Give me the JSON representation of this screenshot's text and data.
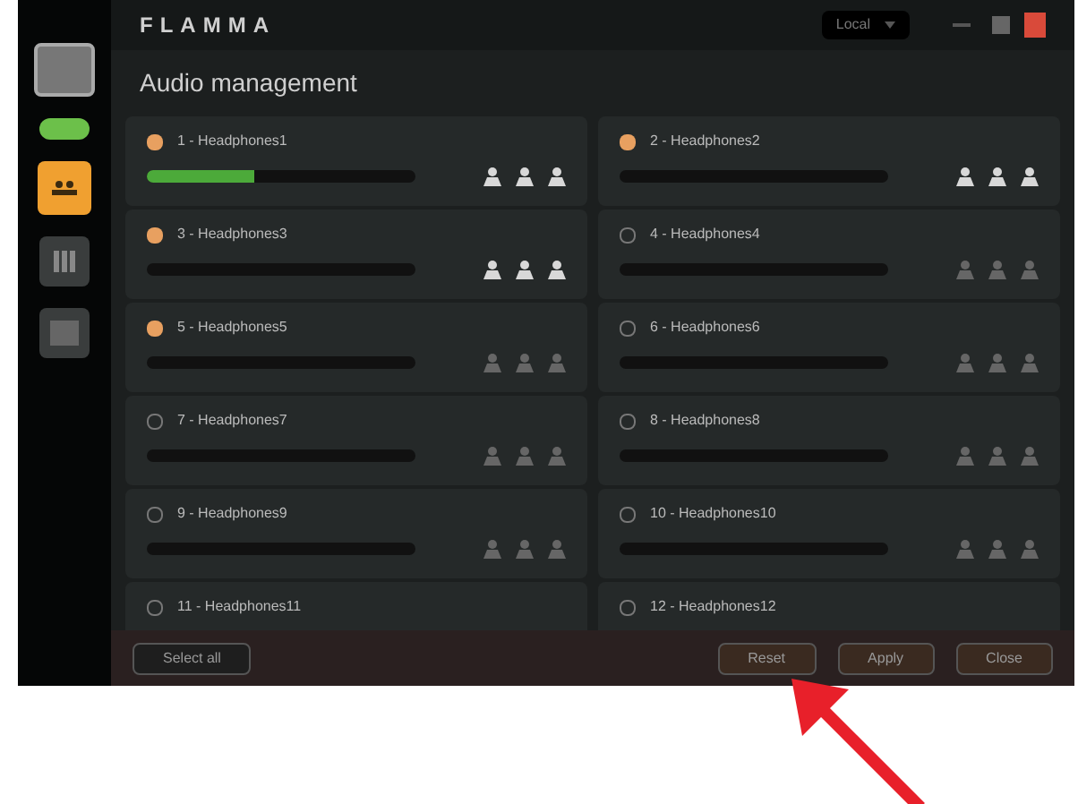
{
  "header": {
    "brand": "FLAMMA",
    "dropdown": "Local"
  },
  "sidebar": {
    "items": [
      {
        "kind": "device",
        "selected": false
      },
      {
        "kind": "toggle",
        "on": true,
        "selected": false
      },
      {
        "kind": "audio",
        "selected": true
      },
      {
        "kind": "grid",
        "selected": false
      },
      {
        "kind": "square",
        "selected": false
      }
    ]
  },
  "title": "Audio management",
  "channels": [
    {
      "label": "1 - Headphones1",
      "checked": true,
      "level": 0.4,
      "active": true
    },
    {
      "label": "2 - Headphones2",
      "checked": true,
      "level": 0,
      "active": true
    },
    {
      "label": "3 - Headphones3",
      "checked": true,
      "level": 0,
      "active": true
    },
    {
      "label": "4 - Headphones4",
      "checked": false,
      "level": 0,
      "active": false
    },
    {
      "label": "5 - Headphones5",
      "checked": true,
      "level": 0,
      "active": false
    },
    {
      "label": "6 - Headphones6",
      "checked": false,
      "level": 0,
      "active": false
    },
    {
      "label": "7 - Headphones7",
      "checked": false,
      "level": 0,
      "active": false
    },
    {
      "label": "8 - Headphones8",
      "checked": false,
      "level": 0,
      "active": false
    },
    {
      "label": "9 - Headphones9",
      "checked": false,
      "level": 0,
      "active": false
    },
    {
      "label": "10 - Headphones10",
      "checked": false,
      "level": 0,
      "active": false
    },
    {
      "label": "11 - Headphones11",
      "checked": false
    },
    {
      "label": "12 - Headphones12",
      "checked": false
    }
  ],
  "footer": {
    "buttons": [
      {
        "label": "Select all",
        "kind": "left"
      },
      {
        "label": "Reset",
        "kind": "right"
      },
      {
        "label": "Apply",
        "kind": "right"
      },
      {
        "label": "Close",
        "kind": "right"
      }
    ]
  }
}
